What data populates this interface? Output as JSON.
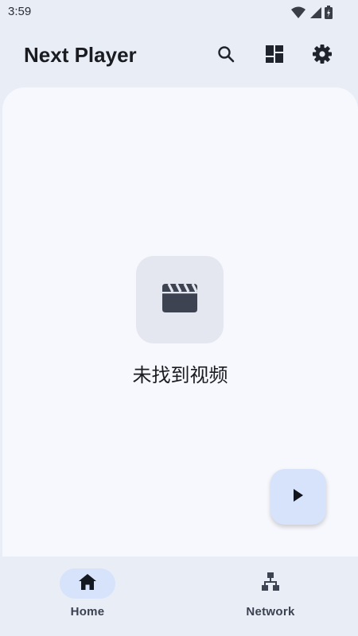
{
  "status_bar": {
    "time": "3:59"
  },
  "app_bar": {
    "title": "Next Player",
    "icons": [
      "search-icon",
      "dashboard-layout-icon",
      "gear-icon"
    ]
  },
  "empty_state": {
    "icon": "movie-clapperboard-icon",
    "message": "未找到视频"
  },
  "fab": {
    "icon": "play-icon"
  },
  "bottom_nav": {
    "items": [
      {
        "label": "Home",
        "icon": "home-icon",
        "selected": true
      },
      {
        "label": "Network",
        "icon": "network-icon",
        "selected": false
      }
    ]
  },
  "colors": {
    "background": "#e9edf5",
    "surface": "#f7f8fd",
    "accent_container": "#d6e3fb",
    "icon_dark": "#3d4350"
  }
}
